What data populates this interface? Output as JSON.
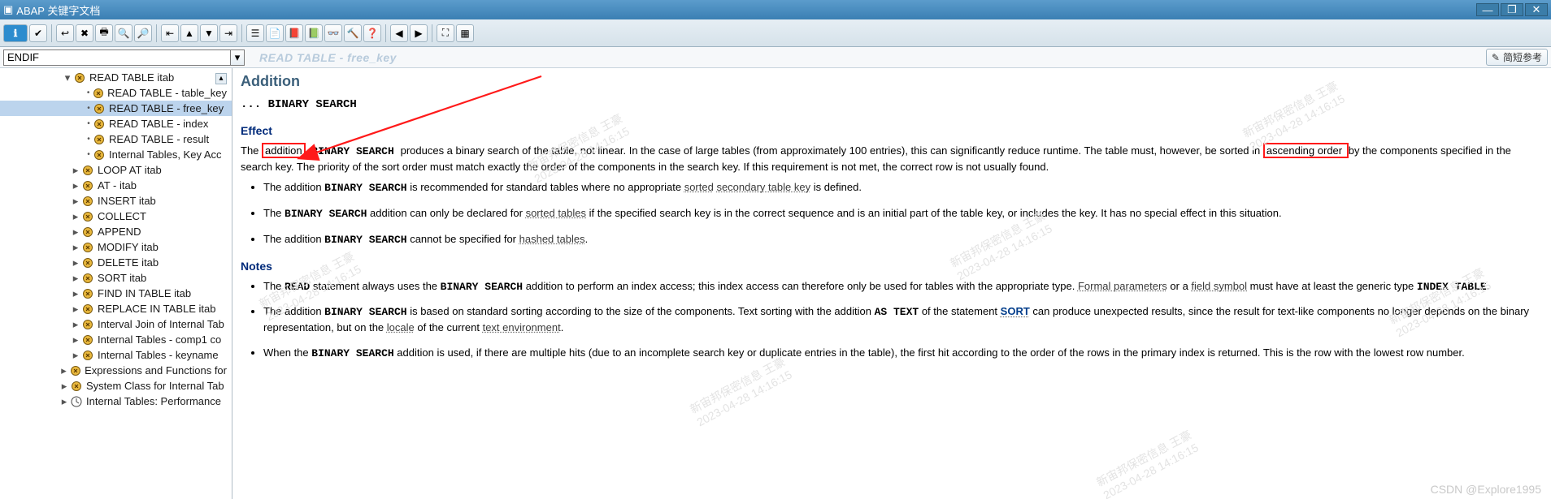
{
  "app_title": "ABAP 关键字文档",
  "toolbar_icons": [
    "menu",
    "check",
    "back",
    "cancel",
    "print",
    "find",
    "findnext",
    "page-first",
    "page-prev",
    "page-next",
    "page-last",
    "layout",
    "new",
    "book1",
    "book2",
    "glasses",
    "hammer",
    "question",
    "nav-left",
    "nav-right",
    "preview",
    "overview"
  ],
  "search_value": "ENDIF",
  "breadcrumb": "READ TABLE - free_key",
  "reflink_label": "简短参考",
  "tree": {
    "top": {
      "label": "READ TABLE itab",
      "children": [
        {
          "label": "READ TABLE - table_key",
          "bullet": true
        },
        {
          "label": "READ TABLE - free_key",
          "bullet": true,
          "selected": true
        },
        {
          "label": "READ TABLE - index",
          "bullet": true
        },
        {
          "label": "READ TABLE - result",
          "bullet": true
        },
        {
          "label": "Internal Tables, Key Acc",
          "bullet": true
        }
      ]
    },
    "rest": [
      {
        "label": "LOOP AT itab"
      },
      {
        "label": "AT - itab"
      },
      {
        "label": "INSERT itab"
      },
      {
        "label": "COLLECT"
      },
      {
        "label": "APPEND"
      },
      {
        "label": "MODIFY itab"
      },
      {
        "label": "DELETE itab"
      },
      {
        "label": "SORT itab"
      },
      {
        "label": "FIND IN TABLE itab"
      },
      {
        "label": "REPLACE IN TABLE itab"
      },
      {
        "label": "Interval Join of Internal Tab"
      },
      {
        "label": "Internal Tables - comp1 co"
      },
      {
        "label": "Internal Tables - keyname"
      }
    ],
    "rest2": [
      {
        "label": "Expressions and Functions for"
      },
      {
        "label": "System Class for Internal Tab"
      },
      {
        "label": "Internal Tables: Performance",
        "clock": true
      }
    ]
  },
  "doc": {
    "h_addition": "Addition",
    "code_line_prefix": "... ",
    "code_line": "BINARY SEARCH",
    "h_effect": "Effect",
    "effect_para_pre": "The ",
    "effect_addition_boxed": "addition",
    "effect_binary_search": " BINARY SEARCH ",
    "effect_para_mid1": "produces a binary search of the table, not linear. In the case of large tables (from approximately 100 entries), this can significantly reduce runtime. The table must, however, be sorted in ",
    "effect_asc_boxed": "ascending order ",
    "effect_para_mid2": "by the components specified in the search key. The priority of the sort order must match exactly the order of the components in the search key. If this requirement is not met, the correct row is not usually found.",
    "effect_bullets": [
      {
        "pre": "The addition ",
        "code": "BINARY SEARCH",
        "post": " is recommended for standard tables where no appropriate ",
        "link1": "sorted",
        "link2": "secondary table key",
        "tail": " is defined."
      },
      {
        "pre": "The ",
        "code": "BINARY SEARCH",
        "post": " addition can only be declared for ",
        "link": "sorted tables",
        "tail": " if the specified search key is in the correct sequence and is an initial part of the table key, or includes the key. It has no special effect in this situation."
      },
      {
        "pre": "The addition ",
        "code": "BINARY SEARCH",
        "post": " cannot be specified for ",
        "link": "hashed tables",
        "tail": "."
      }
    ],
    "h_notes": "Notes",
    "notes_bullets": [
      {
        "pre": "The ",
        "code": "READ",
        "mid": " statement always uses the ",
        "code2": "BINARY SEARCH",
        "post": " addition to perform an index access; this index access can therefore only be used for tables with the appropriate type. ",
        "link": "Formal parameters",
        "tail": " or a ",
        "link2": "field symbol",
        "tail2": " must have at least the generic type ",
        "code3": "INDEX TABLE",
        "end": "."
      },
      {
        "pre": "The addition ",
        "code": "BINARY SEARCH",
        "post": " is based on standard sorting according to the size of the components. Text sorting with the addition ",
        "code2": "AS TEXT",
        "mid": " of the statement ",
        "link": "SORT",
        "tail": " can produce unexpected results, since the result for text-like components no longer depends on the binary representation, but on the ",
        "link2": "locale",
        "tail2": " of the current ",
        "link3": "text environment",
        "end": "."
      },
      {
        "pre": "When the ",
        "code": "BINARY SEARCH",
        "post": " addition is used, if there are multiple hits (due to an incomplete search key or duplicate entries in the table), the first hit according to the order of the rows in the primary index is returned. This is the row with the lowest row number."
      }
    ]
  },
  "watermarks": [
    {
      "text": "新宙邦保密信息 王豪",
      "date": "2023-04-28 14:16:15",
      "style": "left:30px; top:250px;"
    },
    {
      "text": "新宙邦保密信息 王豪",
      "date": "2023-04-28 14:16:15",
      "style": "left:360px; top:80px;"
    },
    {
      "text": "新宙邦保密信息 王豪",
      "date": "2023-04-28 14:16:15",
      "style": "left:560px; top:380px;"
    },
    {
      "text": "新宙邦保密信息 王豪",
      "date": "2023-04-28 14:16:15",
      "style": "left:880px; top:200px;"
    },
    {
      "text": "新宙邦保密信息 王豪",
      "date": "2023-04-28 14:16:15",
      "style": "left:1060px; top:470px;"
    },
    {
      "text": "新宙邦保密信息 王豪",
      "date": "2023-04-28 14:16:15",
      "style": "left:1240px; top:40px;"
    },
    {
      "text": "新宙邦保密信息 王豪",
      "date": "2023-04-28 14:16:15",
      "style": "left:1420px; top:270px;"
    }
  ],
  "csdn": "CSDN @Explore1995"
}
